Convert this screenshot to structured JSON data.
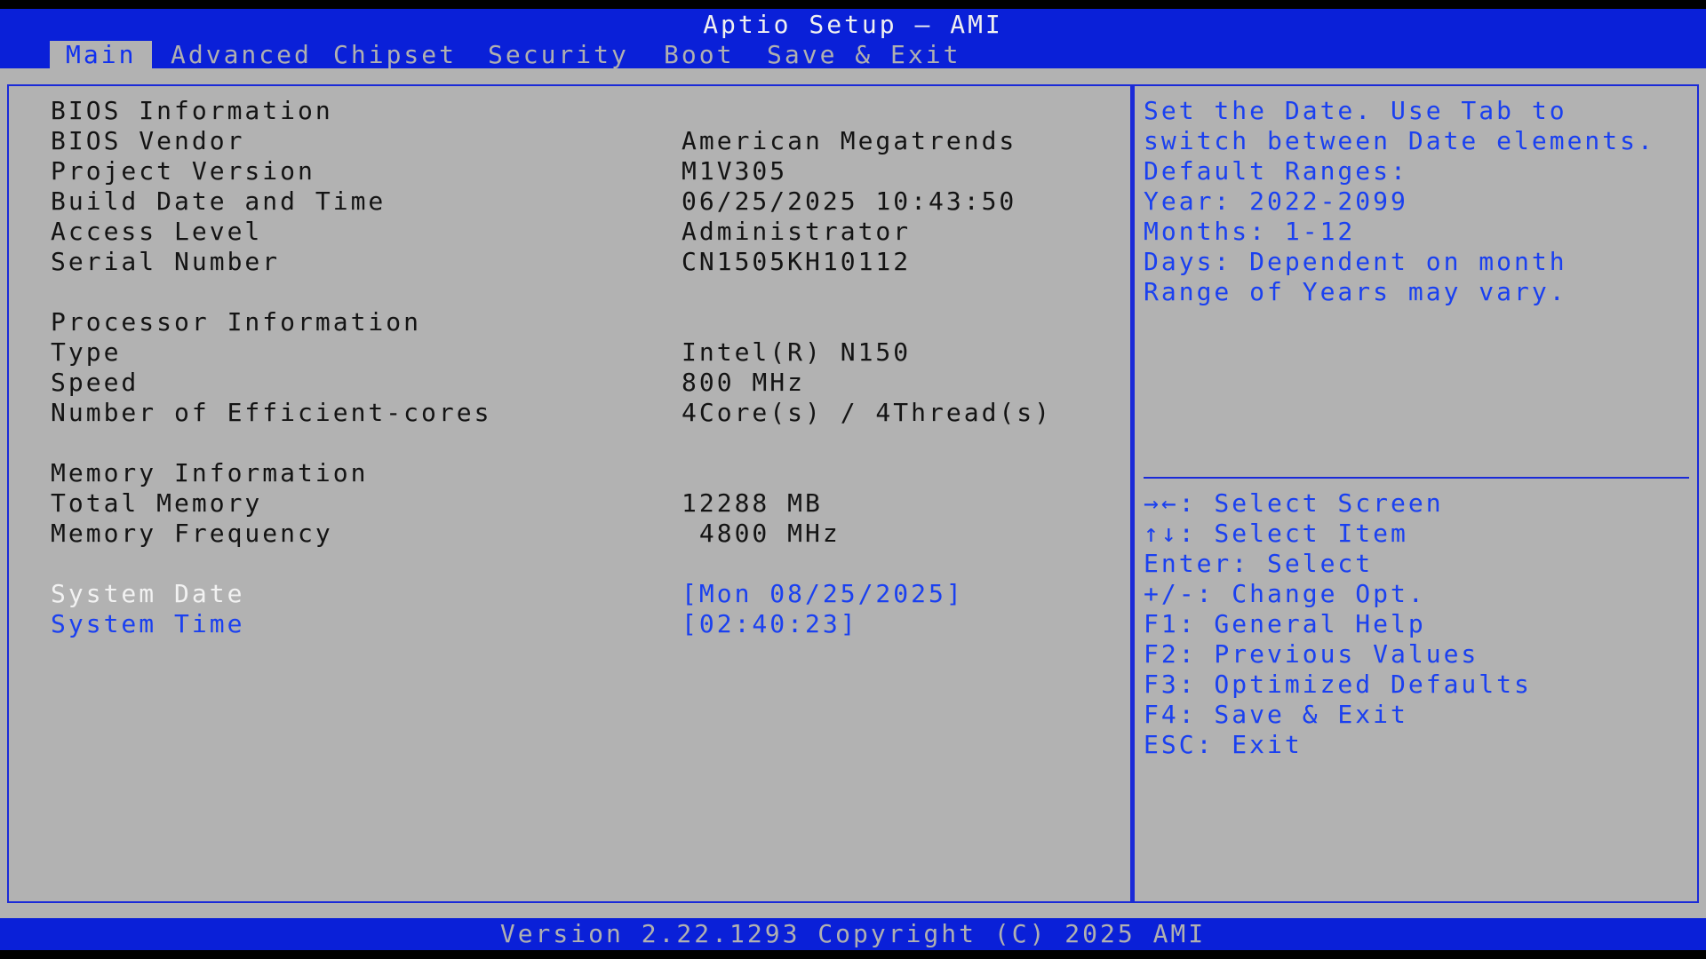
{
  "app": {
    "title": "Aptio Setup – AMI"
  },
  "tabs": [
    {
      "label": "Main",
      "active": true
    },
    {
      "label": "Advanced"
    },
    {
      "label": "Chipset"
    },
    {
      "label": "Security"
    },
    {
      "label": "Boot"
    },
    {
      "label": "Save & Exit"
    }
  ],
  "bios": {
    "header": "BIOS Information",
    "vendor": {
      "label": "BIOS Vendor",
      "value": "American Megatrends"
    },
    "project_version": {
      "label": "Project Version",
      "value": "M1V305"
    },
    "build_date": {
      "label": "Build Date and Time",
      "value": "06/25/2025 10:43:50"
    },
    "access_level": {
      "label": "Access Level",
      "value": "Administrator"
    },
    "serial_number": {
      "label": "Serial Number",
      "value": "CN1505KH10112"
    }
  },
  "processor": {
    "header": "Processor Information",
    "type": {
      "label": "Type",
      "value": "Intel(R) N150"
    },
    "speed": {
      "label": "Speed",
      "value": "800 MHz"
    },
    "cores": {
      "label": "Number of Efficient-cores",
      "value": "4Core(s) / 4Thread(s)"
    }
  },
  "memory": {
    "header": "Memory Information",
    "total": {
      "label": "Total Memory",
      "value": "12288 MB"
    },
    "frequency": {
      "label": "Memory Frequency",
      "value": " 4800 MHz"
    }
  },
  "system_date": {
    "label": "System Date",
    "value": "[Mon 08/25/2025]"
  },
  "system_time": {
    "label": "System Time",
    "value": "[02:40:23]"
  },
  "help": {
    "lines": [
      "Set the Date. Use Tab to",
      "switch between Date elements.",
      "Default Ranges:",
      "Year: 2022-2099",
      "Months: 1-12",
      "Days: Dependent on month",
      "Range of Years may vary."
    ]
  },
  "keys": [
    "→←: Select Screen",
    "↑↓: Select Item",
    "Enter: Select",
    "+/-: Change Opt.",
    "F1: General Help",
    "F2: Previous Values",
    "F3: Optimized Defaults",
    "F4: Save & Exit",
    "ESC: Exit"
  ],
  "footer": {
    "text": "Version 2.22.1293 Copyright (C) 2025 AMI"
  },
  "colors": {
    "header_blue": "#0a20d8",
    "panel_gray": "#b2b2b2",
    "select_blue": "#1a40f0"
  }
}
